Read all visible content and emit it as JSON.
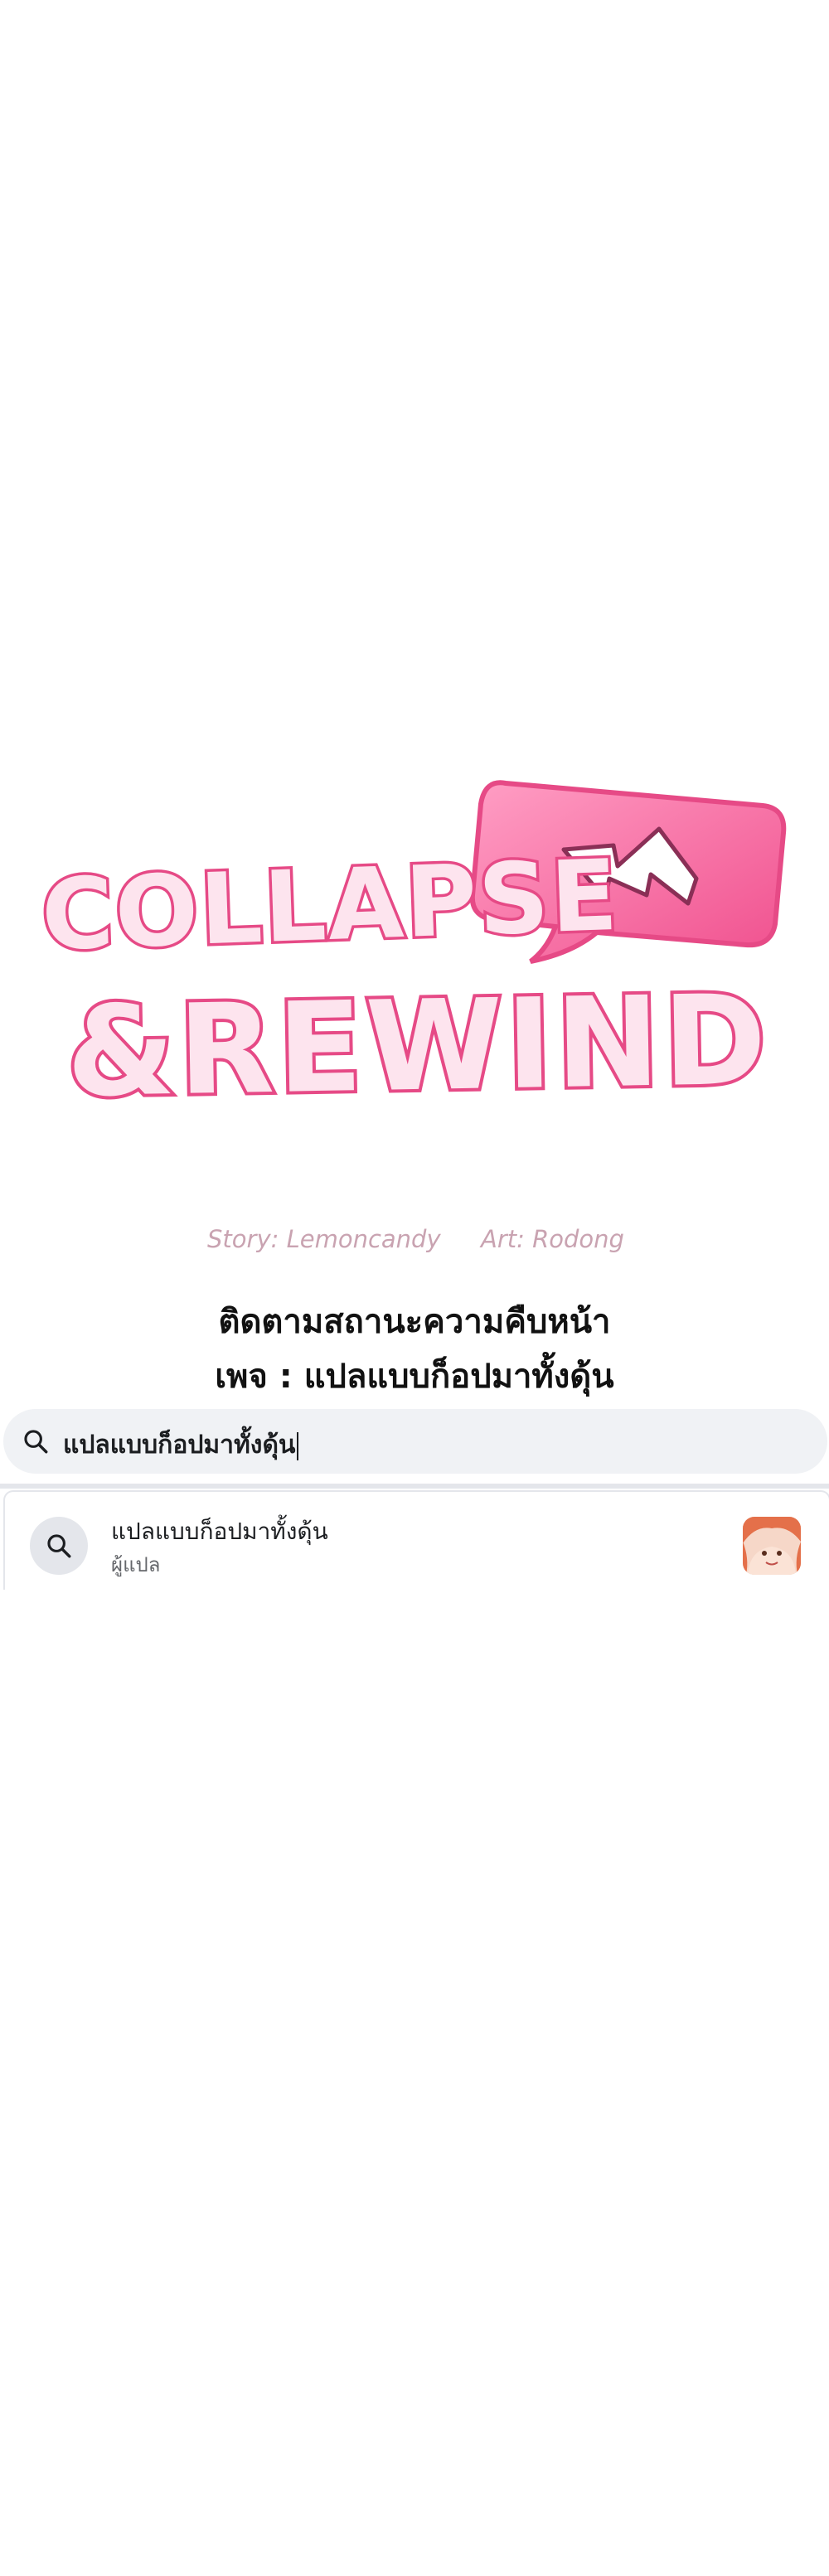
{
  "comic": {
    "title_line1": "COLLAPSE",
    "title_line2": "&REWIND",
    "story_credit": "Story: Lemoncandy",
    "art_credit": "Art: Rodong",
    "logo_icon": "rewind-icon"
  },
  "promo": {
    "line1": "ติดตามสถานะความคืบหน้า",
    "line2": "เพจ : แปลแบบก็อปมาทั้งดุ้น"
  },
  "search": {
    "query": "แปลแบบก็อปมาทั้งดุ้น",
    "icon": "search-icon"
  },
  "result": {
    "name": "แปลแบบก็อปมาทั้งดุ้น",
    "subtitle": "ผู้แปล",
    "icon": "search-icon",
    "avatar_icon": "profile-avatar"
  },
  "colors": {
    "logo_pink": "#f25f9a",
    "logo_light": "#fde4ee",
    "search_bg": "#f0f2f5",
    "text_dark": "#1c1e21",
    "text_muted": "#65676b"
  }
}
